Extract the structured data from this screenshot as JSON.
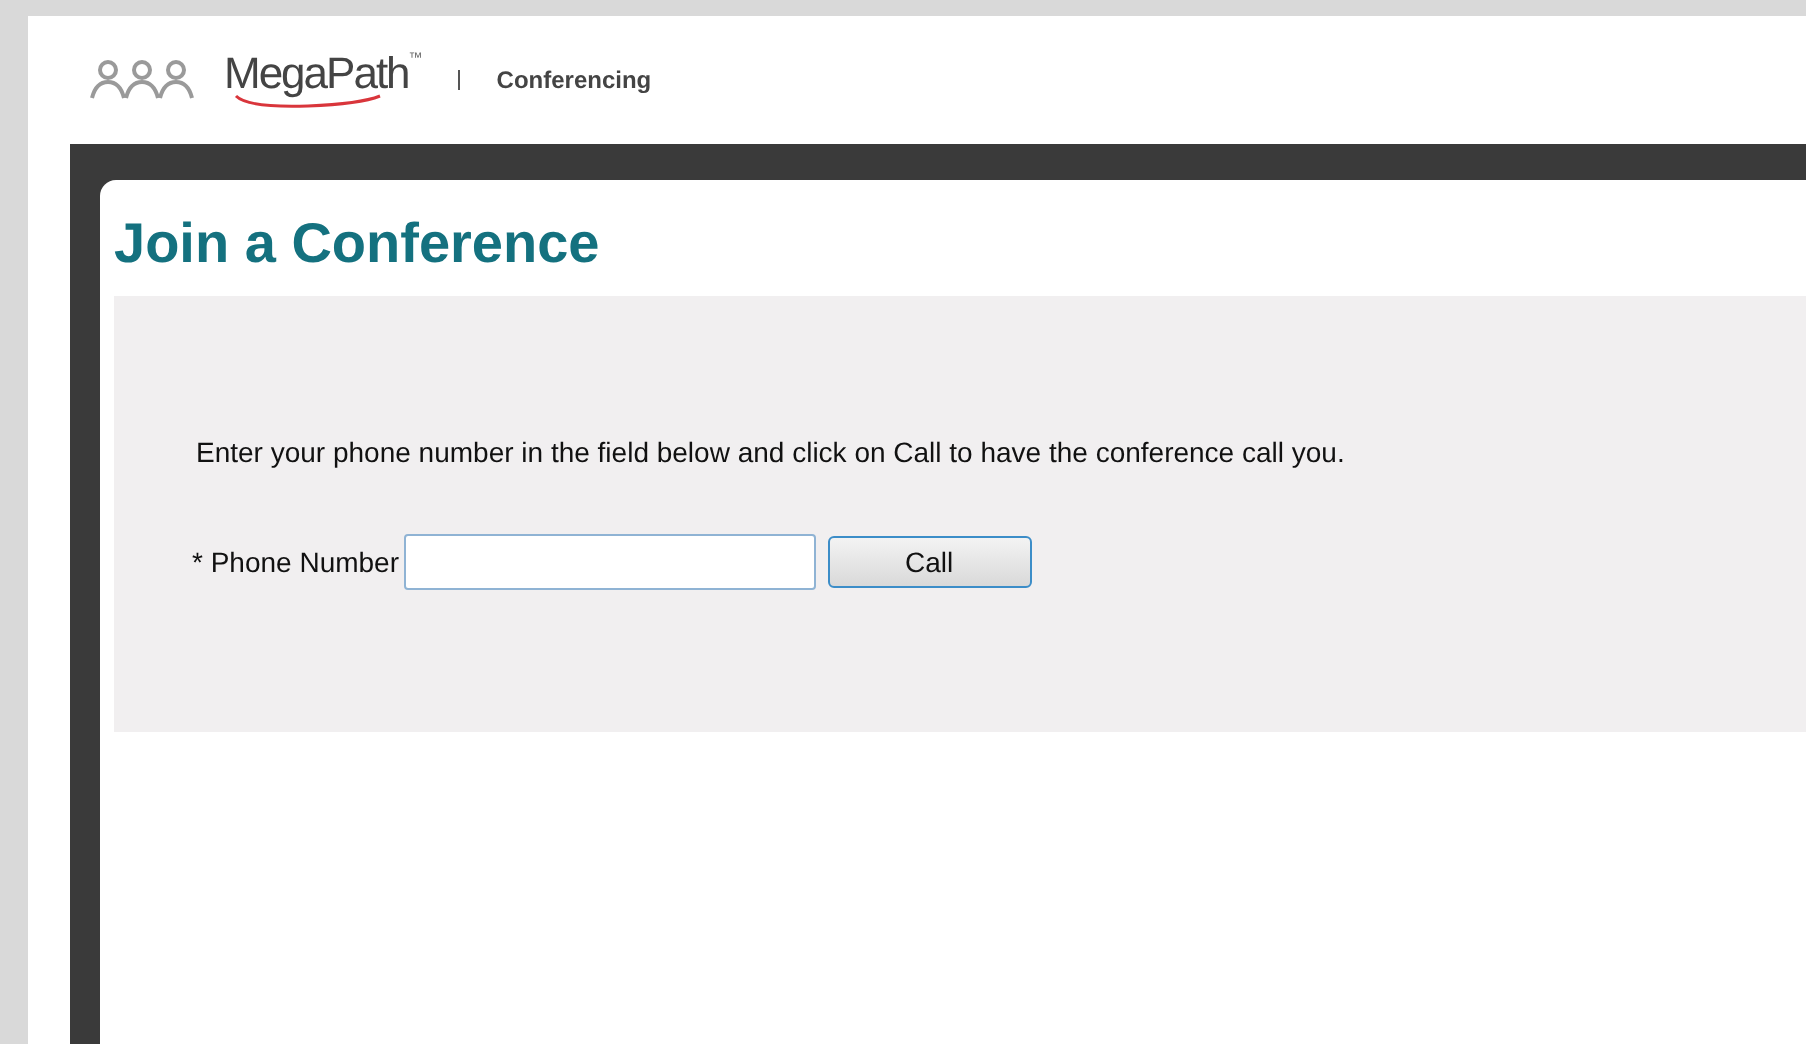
{
  "header": {
    "brand": "MegaPath",
    "trademark": "™",
    "section": "Conferencing"
  },
  "page": {
    "title": "Join a Conference",
    "instructions": "Enter your phone number in the field below and click on Call to have the conference call you.",
    "phone_label": "* Phone Number",
    "call_button": "Call"
  }
}
